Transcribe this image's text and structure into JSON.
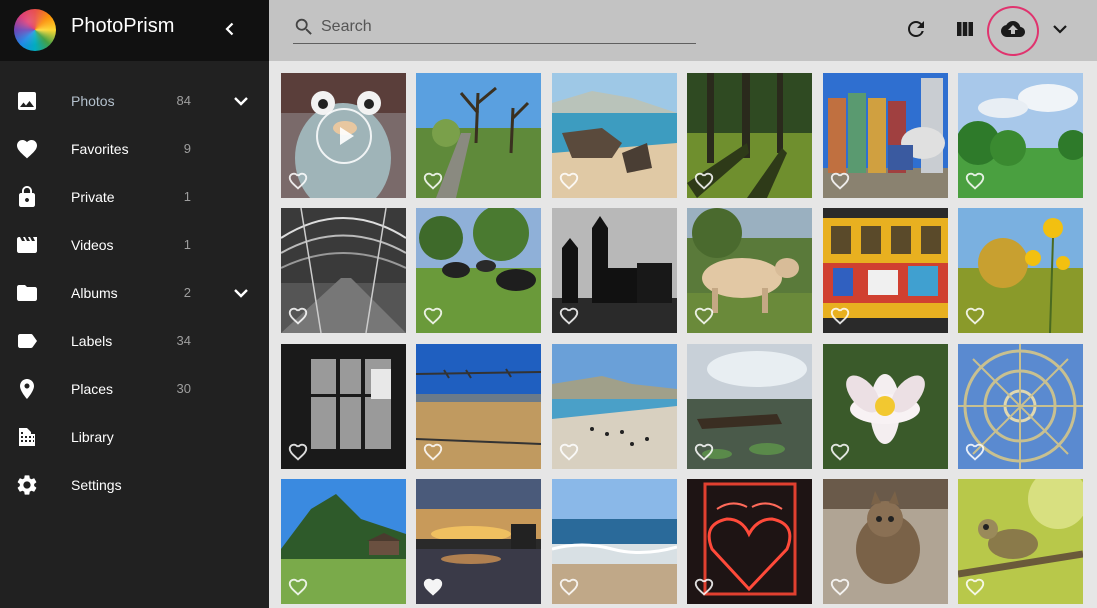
{
  "app": {
    "title": "PhotoPrism"
  },
  "nav": {
    "items": [
      {
        "label": "Photos",
        "count": "84",
        "icon": "image-icon",
        "expandable": true,
        "active": true
      },
      {
        "label": "Favorites",
        "count": "9",
        "icon": "heart-icon",
        "expandable": false
      },
      {
        "label": "Private",
        "count": "1",
        "icon": "lock-icon",
        "expandable": false
      },
      {
        "label": "Videos",
        "count": "1",
        "icon": "movie-icon",
        "expandable": false
      },
      {
        "label": "Albums",
        "count": "2",
        "icon": "folder-icon",
        "expandable": true
      },
      {
        "label": "Labels",
        "count": "34",
        "icon": "label-icon",
        "expandable": false
      },
      {
        "label": "Places",
        "count": "30",
        "icon": "place-icon",
        "expandable": false
      },
      {
        "label": "Library",
        "count": "",
        "icon": "library-icon",
        "expandable": false
      },
      {
        "label": "Settings",
        "count": "",
        "icon": "gear-icon",
        "expandable": false
      }
    ]
  },
  "toolbar": {
    "search_placeholder": "Search",
    "buttons": [
      "refresh-icon",
      "view-columns-icon",
      "cloud-upload-icon",
      "chevron-down-icon"
    ],
    "highlight_color": "#e0336e"
  },
  "photos": [
    {
      "subject": "plush gopher toy",
      "video": true,
      "favorite": false
    },
    {
      "subject": "orchard with bare trees",
      "favorite": false
    },
    {
      "subject": "rocky beach",
      "favorite": false
    },
    {
      "subject": "forest shadows",
      "favorite": false
    },
    {
      "subject": "painted silos and cement truck",
      "favorite": false
    },
    {
      "subject": "green garden under sky",
      "favorite": false
    },
    {
      "subject": "glass dome interior",
      "favorite": false
    },
    {
      "subject": "buffalo on pasture",
      "favorite": false
    },
    {
      "subject": "castle silhouette",
      "favorite": false
    },
    {
      "subject": "cow in field",
      "favorite": false
    },
    {
      "subject": "graffiti train",
      "favorite": false
    },
    {
      "subject": "yellow flowers",
      "favorite": false
    },
    {
      "subject": "window silhouette",
      "favorite": false
    },
    {
      "subject": "barbed wire landscape",
      "favorite": false
    },
    {
      "subject": "penguin beach",
      "favorite": false
    },
    {
      "subject": "marsh with old boat",
      "favorite": false
    },
    {
      "subject": "water lily",
      "favorite": false
    },
    {
      "subject": "dome from below",
      "favorite": false
    },
    {
      "subject": "alpine meadow",
      "favorite": false
    },
    {
      "subject": "sunset over river",
      "favorite": true
    },
    {
      "subject": "ocean waves",
      "favorite": false
    },
    {
      "subject": "neon heart sign",
      "favorite": false
    },
    {
      "subject": "cat on carpet",
      "favorite": false
    },
    {
      "subject": "chameleon on branch",
      "favorite": false
    }
  ]
}
